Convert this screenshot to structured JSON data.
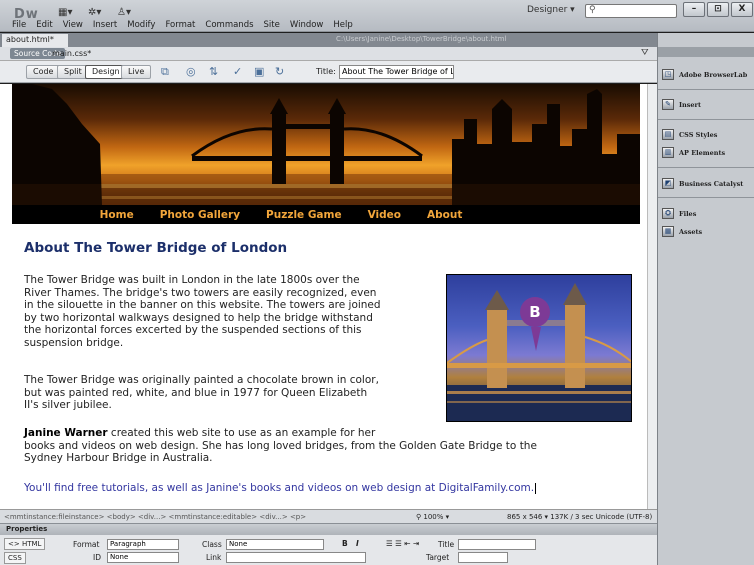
{
  "app": {
    "logo": "Dw",
    "workspace": "Designer",
    "menu": [
      "File",
      "Edit",
      "View",
      "Insert",
      "Modify",
      "Format",
      "Commands",
      "Site",
      "Window",
      "Help"
    ],
    "window_buttons": [
      "–",
      "⊡",
      "X"
    ]
  },
  "document": {
    "tab": "about.html*",
    "path": "C:\\Users\\Janine\\Desktop\\TowerBridge\\about.html",
    "source_code": "Source Code",
    "related_file": "main.css*",
    "views": [
      "Code",
      "Split",
      "Design",
      "Live"
    ],
    "active_view": "Design",
    "title_label": "Title:",
    "title_value": "About The Tower Bridge of Lon"
  },
  "page": {
    "nav": [
      "Home",
      "Photo Gallery",
      "Puzzle Game",
      "Video",
      "About"
    ],
    "heading": "About The Tower Bridge of London",
    "p1": [
      "The Tower Bridge was built in London in the late 1800s over the",
      "River Thames. The bridge's two towers are easily recognized, even",
      "in the silouette in the banner on this website. The towers are joined",
      "by two horizontal walkways designed to help the bridge withstand",
      "the horizontal forces excerted by the suspended sections of this",
      "suspension bridge."
    ],
    "p2": [
      "The Tower Bridge was originally painted a chocolate brown in color,",
      "but was painted red, white, and blue in 1977 for Queen Elizabeth",
      "II's silver jubilee."
    ],
    "p3_bold": "Janine Warner",
    "p3_rest_line1": " created this web site to use as an example for her",
    "p3_line2": "books and videos on web design. She has long loved bridges, from the Golden Gate Bridge to the",
    "p3_line3": "Sydney Harbour Bridge in Australia.",
    "p4": "You'll find free tutorials, as well as Janine's books and videos on web design at DigitalFamily.com.",
    "callout": "B"
  },
  "status": {
    "tags": "<mmtinstance:fileinstance> <body> <div...> <mmtinstance:editable> <div...> <p>",
    "zoom": "100%",
    "size": "865 x 546 ▾ 137K / 3 sec Unicode (UTF-8)"
  },
  "properties": {
    "header": "Properties",
    "html_btn": "<> HTML",
    "css_btn": "CSS",
    "format_label": "Format",
    "format_value": "Paragraph",
    "class_label": "Class",
    "class_value": "None",
    "id_label": "ID",
    "id_value": "None",
    "link_label": "Link",
    "title_label": "Title",
    "target_label": "Target"
  },
  "panels": [
    "Adobe BrowserLab",
    "Insert",
    "CSS Styles",
    "AP Elements",
    "Business Catalyst",
    "Files",
    "Assets"
  ],
  "colors": {
    "heading": "#1c2f6a",
    "nav_text": "#f2a63b",
    "callout": "#7d3a96",
    "link_text": "#3336a0"
  }
}
